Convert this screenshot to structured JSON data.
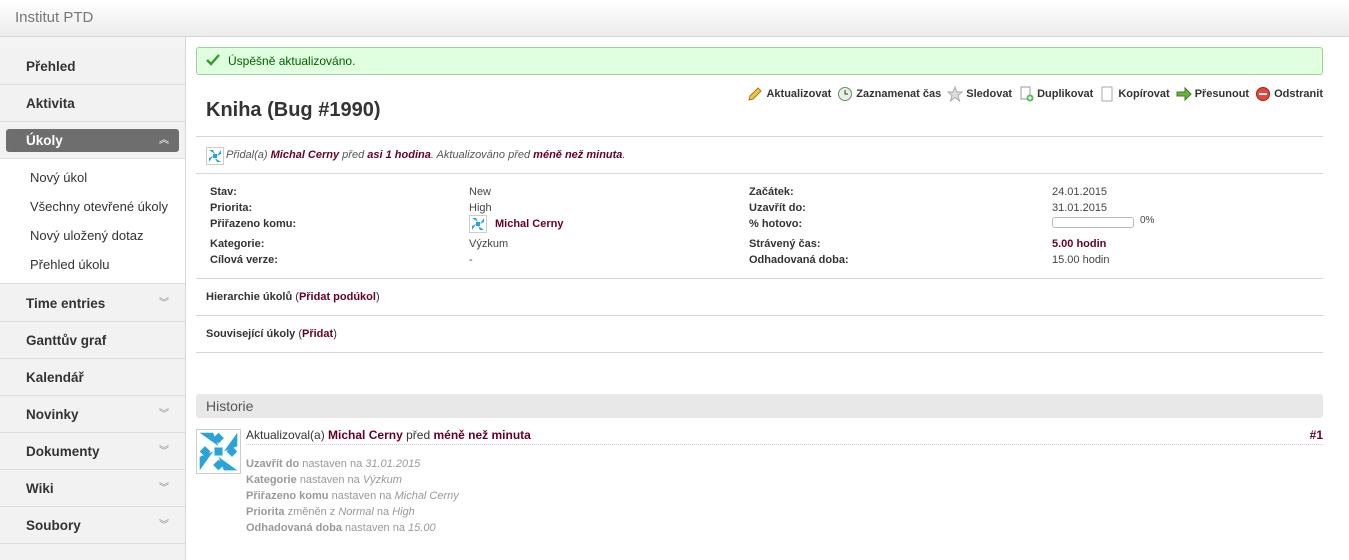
{
  "app": {
    "title": "Institut PTD"
  },
  "sidebar": {
    "items": [
      {
        "label": "Přehled",
        "expandable": false
      },
      {
        "label": "Aktivita",
        "expandable": false
      },
      {
        "label": "Úkoly",
        "expandable": true,
        "active": true
      },
      {
        "label": "Time entries",
        "expandable": true
      },
      {
        "label": "Ganttův graf",
        "expandable": false
      },
      {
        "label": "Kalendář",
        "expandable": false
      },
      {
        "label": "Novinky",
        "expandable": true
      },
      {
        "label": "Dokumenty",
        "expandable": true
      },
      {
        "label": "Wiki",
        "expandable": true
      },
      {
        "label": "Soubory",
        "expandable": true
      }
    ],
    "submenu": [
      "Nový úkol",
      "Všechny otevřené úkoly",
      "Nový uložený dotaz",
      "Přehled úkolu"
    ]
  },
  "flash": {
    "message": "Úspěšně aktualizováno."
  },
  "issue": {
    "title": "Kniha (Bug #1990)",
    "actions": [
      "Aktualizovat",
      "Zaznamenat čas",
      "Sledovat",
      "Duplikovat",
      "Kopírovat",
      "Přesunout",
      "Odstranit"
    ],
    "author": {
      "prefix": "Přidal(a)",
      "name": "Michal Cerny",
      "mid": "před",
      "time": "asi 1 hodina",
      "updated_prefix": ". Aktualizováno před",
      "updated_time": "méně než minuta",
      "suffix": "."
    },
    "attributes": {
      "status_label": "Stav:",
      "status": "New",
      "priority_label": "Priorita:",
      "priority": "High",
      "assignee_label": "Přiřazeno komu:",
      "assignee": "Michal Cerny",
      "category_label": "Kategorie:",
      "category": "Výzkum",
      "version_label": "Cílová verze:",
      "version": "-",
      "start_label": "Začátek:",
      "start": "24.01.2015",
      "due_label": "Uzavřít do:",
      "due": "31.01.2015",
      "done_label": "% hotovo:",
      "done": "0%",
      "done_fraction": 0,
      "spent_label": "Strávený čas:",
      "spent": "5.00 hodin",
      "estimated_label": "Odhadovaná doba:",
      "estimated": "15.00 hodin"
    },
    "subtasks": {
      "label": "Hierarchie úkolů",
      "link": "Přidat podúkol"
    },
    "relations": {
      "label": "Související úkoly",
      "link": "Přidat"
    }
  },
  "history": {
    "title": "Historie",
    "entry": {
      "prefix": "Aktualizoval(a)",
      "author": "Michal Cerny",
      "mid": "před",
      "time": "méně než minuta",
      "number": "#1",
      "details": [
        {
          "field": "Uzavřít do",
          "verb": "nastaven na",
          "value": "31.01.2015"
        },
        {
          "field": "Kategorie",
          "verb": "nastaven na",
          "value": "Výzkum"
        },
        {
          "field": "Přiřazeno komu",
          "verb": "nastaven na",
          "value": "Michal Cerny"
        },
        {
          "field": "Priorita",
          "verb": "změněn z",
          "old": "Normal",
          "verb2": "na",
          "value": "High"
        },
        {
          "field": "Odhadovaná doba",
          "verb": "nastaven na",
          "value": "15.00"
        }
      ]
    }
  },
  "colors": {
    "link": "#660022",
    "flash_bg": "#dfffdf",
    "sidebar_active": "#6e6e6e"
  }
}
